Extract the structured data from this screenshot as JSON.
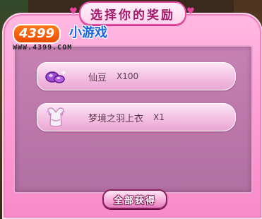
{
  "dialog": {
    "title": "选择你的奖励",
    "logo": {
      "brand_number": "4399",
      "brand_text": "小游戏",
      "url": "WWW.4399.COM"
    },
    "rewards": [
      {
        "icon": "purple-bean-icon",
        "name": "仙豆",
        "quantity": "X100"
      },
      {
        "icon": "feather-top-icon",
        "name": "梦境之羽上衣",
        "quantity": "X1"
      }
    ],
    "claim_all_label": "全部获得"
  },
  "colors": {
    "accent_pink": "#e94aa6",
    "panel_pink": "#ff9ed4",
    "inner_purple": "#b16fa2"
  }
}
